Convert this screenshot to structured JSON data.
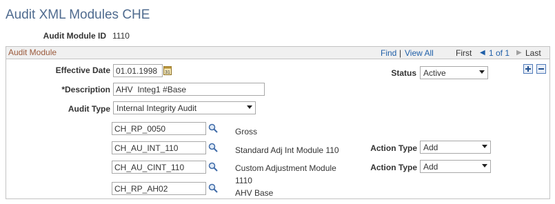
{
  "page": {
    "title": "Audit XML Modules CHE"
  },
  "header": {
    "audit_module_id_label": "Audit Module ID",
    "audit_module_id_value": "1110"
  },
  "group": {
    "title": "Audit Module",
    "nav": {
      "find": "Find",
      "separator": "|",
      "view_all": "View All",
      "first": "First",
      "range": "1 of 1",
      "last": "Last"
    }
  },
  "form": {
    "effective_date_label": "Effective Date",
    "effective_date_value": "01.01.1998",
    "status_label": "Status",
    "status_value": "Active",
    "description_label": "*Description",
    "description_value": "AHV  Integ1 #Base",
    "audit_type_label": "Audit Type",
    "audit_type_value": "Internal Integrity Audit"
  },
  "rows": [
    {
      "code": "CH_RP_0050",
      "desc": "Gross",
      "desc2": "",
      "action_label": "",
      "action_value": ""
    },
    {
      "code": "CH_AU_INT_110",
      "desc": "Standard Adj Int Module 110",
      "desc2": "",
      "action_label": "Action Type",
      "action_value": "Add"
    },
    {
      "code": "CH_AU_CINT_110",
      "desc": "Custom Adjustment Module",
      "desc2": "1110",
      "action_label": "Action Type",
      "action_value": "Add"
    },
    {
      "code": "CH_RP_AH02",
      "desc": "AHV Base",
      "desc2": "",
      "action_label": "",
      "action_value": ""
    }
  ],
  "icons": {
    "calendar": "calendar-icon",
    "lookup": "search-icon",
    "add": "plus-icon",
    "remove": "minus-icon"
  },
  "colors": {
    "title": "#4f6b8f",
    "group_title": "#9b5a3c",
    "link": "#1f5fa8"
  }
}
